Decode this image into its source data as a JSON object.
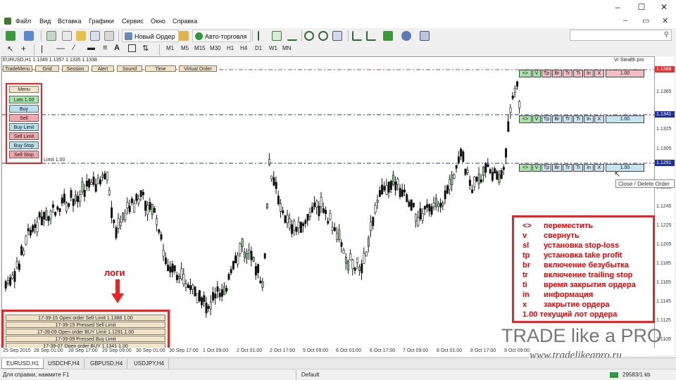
{
  "menubar": {
    "items": [
      "Файл",
      "Вид",
      "Вставка",
      "Графики",
      "Сервис",
      "Окно",
      "Справка"
    ]
  },
  "toolbar": {
    "new_order_label": "Новый Ордер",
    "autotrading_label": "Авто-торговля",
    "timeframes": [
      "M1",
      "M5",
      "M15",
      "M30",
      "H1",
      "H4",
      "D1",
      "W1",
      "MN"
    ]
  },
  "chart": {
    "header": "EURUSD,H1  1.1349 1.1357 1.1335 1.1338",
    "ea_name": "Vr Stealth pro",
    "top_tabs": [
      "TradeMenu",
      "Grid",
      "Session",
      "Alert",
      "Sound",
      "Time",
      "Virtual Order"
    ],
    "price_labels": [
      "1.1365",
      "1.1325",
      "1.1305",
      "1.1265",
      "1.1245",
      "1.1225",
      "1.1205",
      "1.1185",
      "1.1165",
      "1.1145",
      "1.1125",
      "1.1105"
    ],
    "price_tags": [
      {
        "value": "1.1388",
        "color": "#e83030"
      },
      {
        "value": "1.1341",
        "color": "#1c2f9c"
      },
      {
        "value": "1.1291",
        "color": "#1c2f9c"
      }
    ],
    "left_line_label": "Limit 1.00",
    "time_labels": [
      "25 Sep 2015",
      "28 Sep 01:00",
      "28 Sep 17:00",
      "29 Sep 09:00",
      "30 Sep 01:00",
      "30 Sep 17:00",
      "1 Oct 09:00",
      "2 Oct 01:00",
      "2 Oct 17:00",
      "5 Oct 09:00",
      "6 Oct 01:00",
      "6 Oct 17:00",
      "7 Oct 09:00",
      "8 Oct 01:00",
      "8 Oct 17:00",
      "9 Oct 09:00"
    ]
  },
  "menu_panel": {
    "title": "Menu",
    "buttons": [
      {
        "label": "Lots 1.00",
        "color": "#a6e6a6"
      },
      {
        "label": "Buy",
        "color": "#b6e0ee"
      },
      {
        "label": "Sell",
        "color": "#f2a8ae"
      },
      {
        "label": "Buy Limit",
        "color": "#b6e0ee"
      },
      {
        "label": "Sell Limit",
        "color": "#f2a8ae"
      },
      {
        "label": "Buy Stop",
        "color": "#b6e0ee"
      },
      {
        "label": "Sell Stop",
        "color": "#f2a8ae"
      }
    ]
  },
  "order_rows": [
    {
      "buttons": [
        "<>",
        "V",
        "Tp",
        "Br",
        "Tr",
        "Ti",
        "In",
        "X"
      ],
      "lot": "1.00",
      "lot_color": "#f2c0c4"
    },
    {
      "buttons": [
        "<>",
        "V",
        "Tp",
        "Br",
        "Tr",
        "Ti",
        "In",
        "X"
      ],
      "lot": "1.00",
      "lot_color": "#c8e4f2"
    },
    {
      "buttons": [
        "<>",
        "V",
        "Tp",
        "Br",
        "Tr",
        "Ti",
        "In",
        "X"
      ],
      "lot": "1.00",
      "lot_color": "#c8e4f2"
    }
  ],
  "tooltip": "Close / Delete Order",
  "legend": [
    {
      "key": "<>",
      "desc": "переместить"
    },
    {
      "key": "v",
      "desc": "свернуть"
    },
    {
      "key": "sl",
      "desc": "установка stop-loss"
    },
    {
      "key": "tp",
      "desc": "установка  take profit"
    },
    {
      "key": "br",
      "desc": "включение безубытка"
    },
    {
      "key": "tr",
      "desc": "включение trailing stop"
    },
    {
      "key": "ti",
      "desc": "время закрытия ордера"
    },
    {
      "key": "in",
      "desc": "информация"
    },
    {
      "key": "x",
      "desc": "закрытие ордера"
    },
    {
      "key": "1.00",
      "desc": "текущий лот ордера"
    }
  ],
  "logs": {
    "label": "логи",
    "rows": [
      "17-39-15 Open order Sell Limit 1.1388 1.00",
      "17-39-15 Pressed Sell Limit",
      "17-39-09 Open order BUY Limit 1.1291 1.00",
      "17-39-09 Pressed Buy Limit",
      "17-39-07 Open order BUY 1.1341 1.00"
    ]
  },
  "watermark": {
    "title": "TRADE like a PRO",
    "url": "www.tradelikeapro.ru"
  },
  "chart_tabs": [
    "EURUSD,H1",
    "USDCHF,H4",
    "GBPUSD,H4",
    "USDJPY,H4"
  ],
  "status": {
    "help": "Для справки, нажмите F1",
    "profile": "Default",
    "traffic": "29583/1 kb"
  }
}
